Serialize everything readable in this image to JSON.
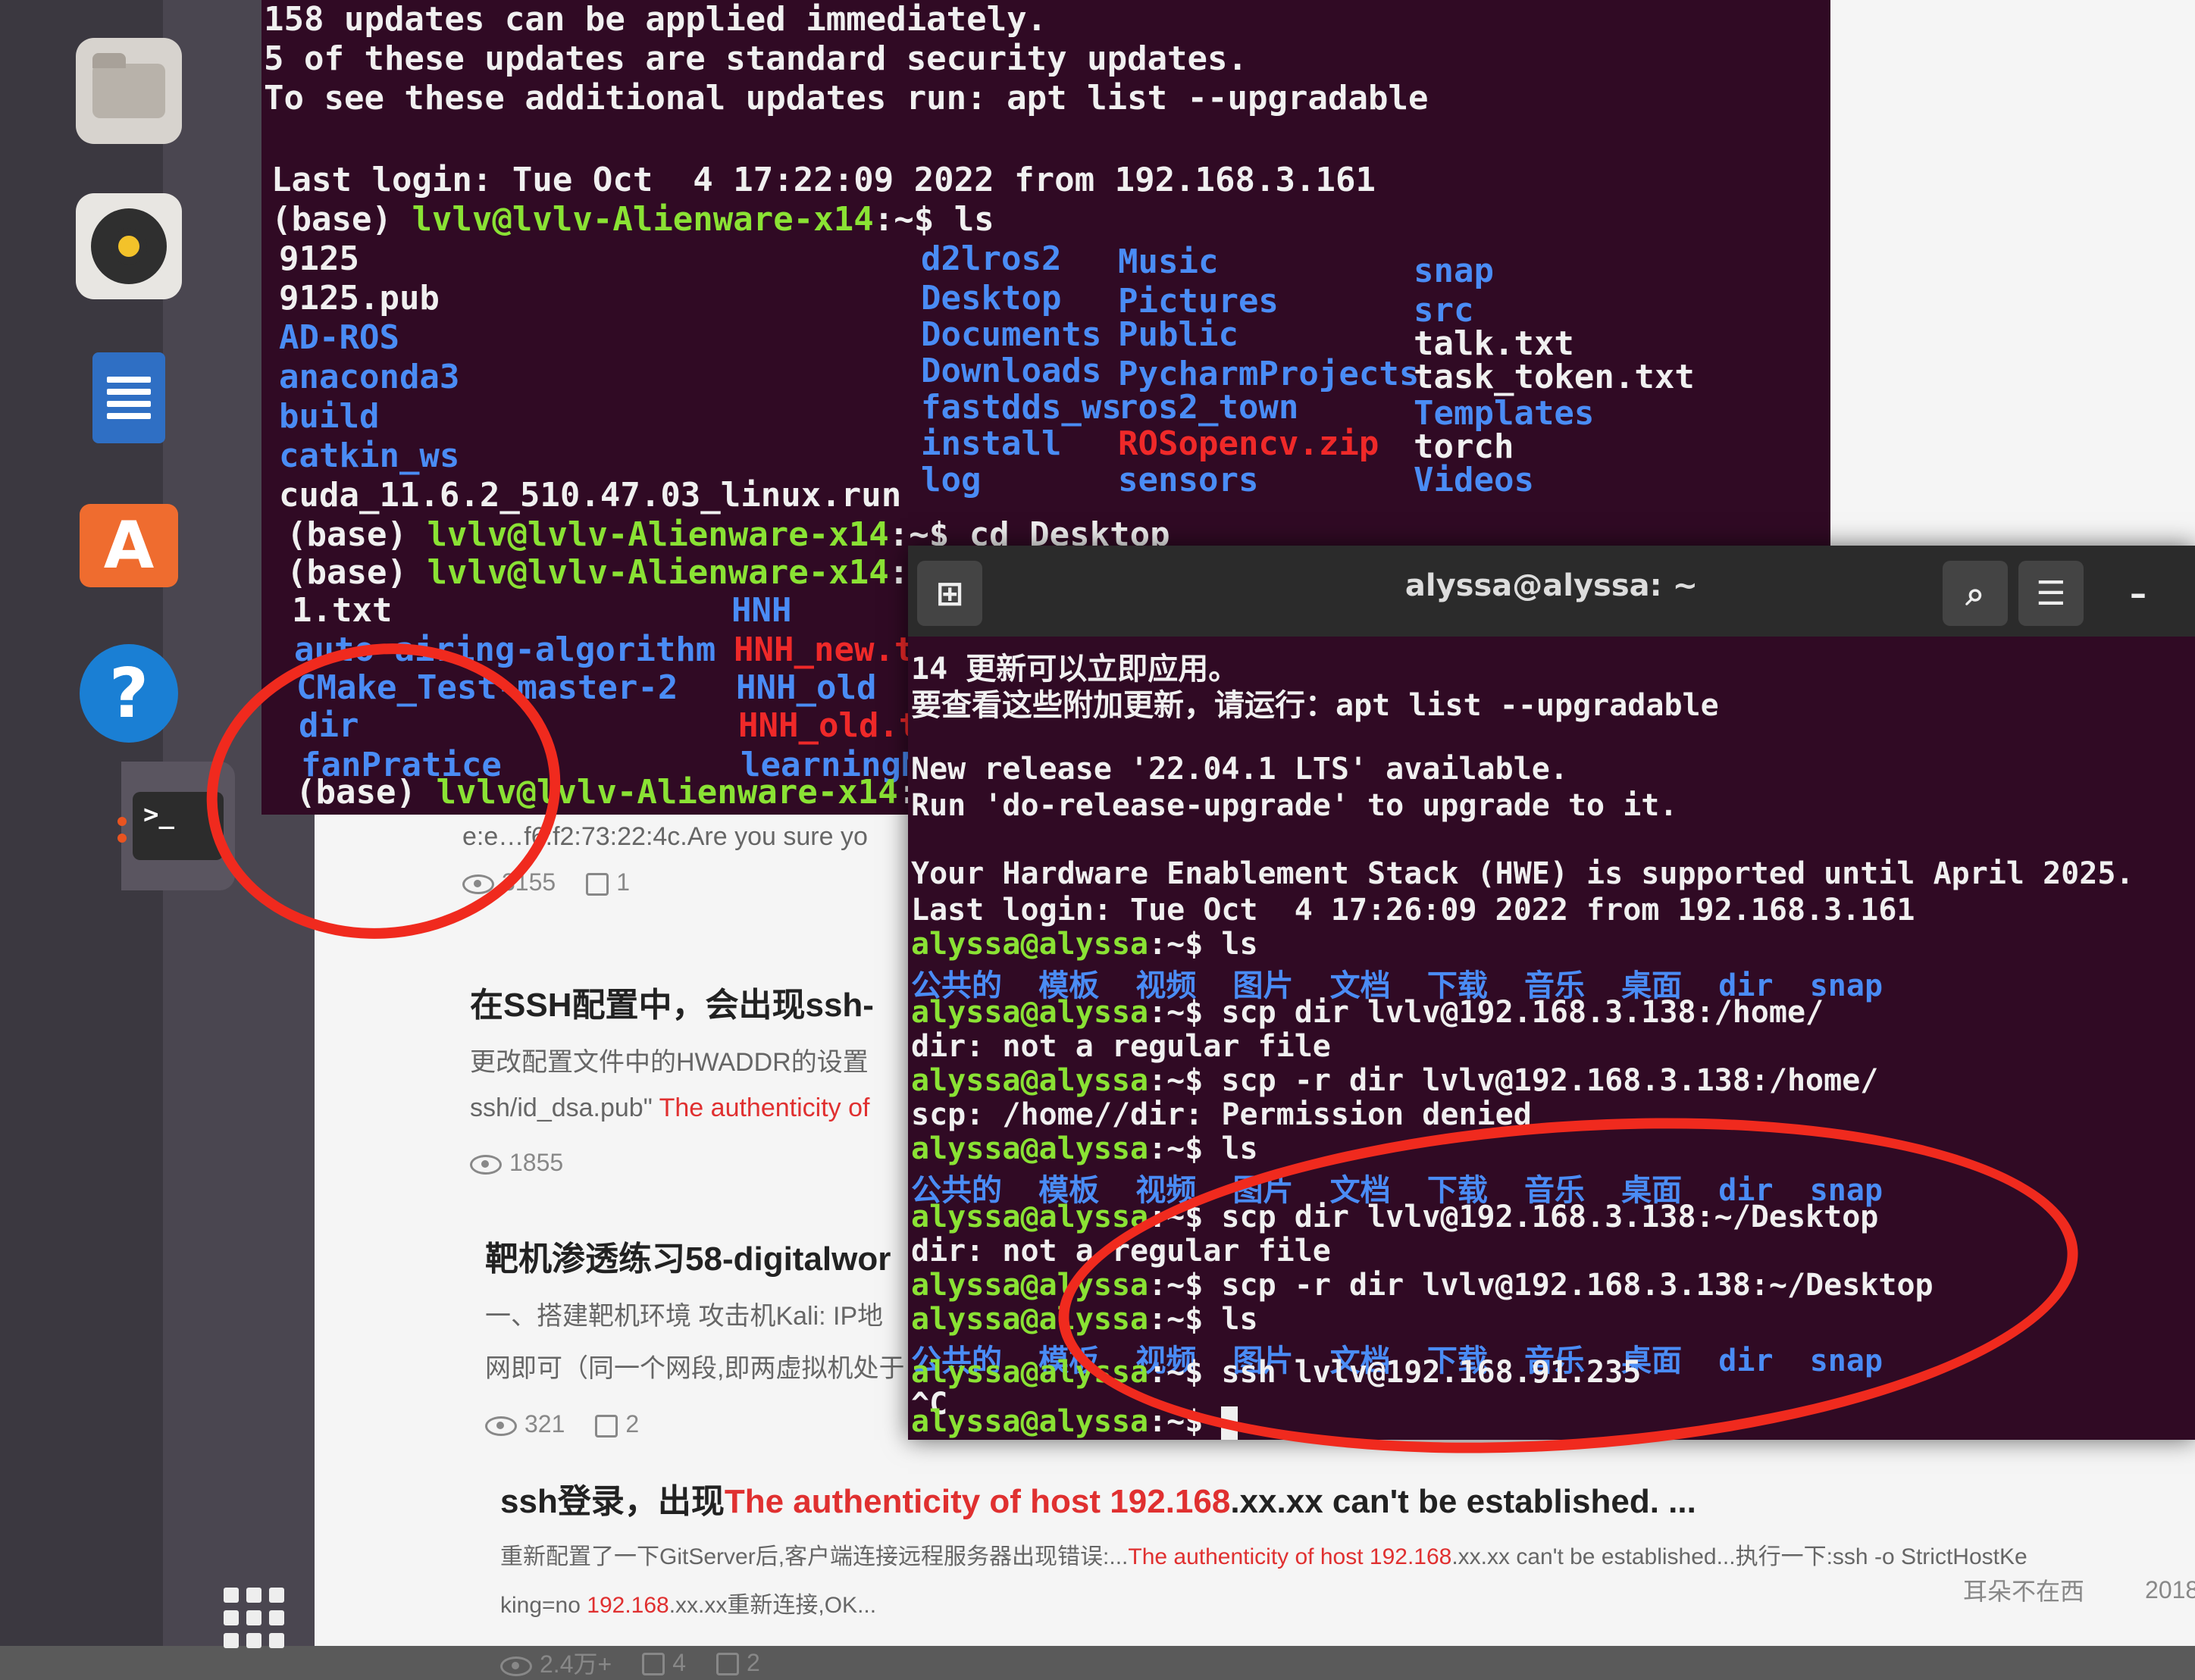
{
  "dock": {
    "items": [
      "files-icon",
      "rhythmbox-icon",
      "writer-icon",
      "software-icon",
      "help-icon",
      "terminal-icon"
    ]
  },
  "browser": {
    "articles": [
      {
        "snippet": "e:e…f6:f2:73:22:4c.Are you sure yo",
        "views": "3155",
        "likes": "1"
      },
      {
        "title": "在SSH配置中，会出现ssh-",
        "excerpt": "更改配置文件中的HWADDR的设置",
        "excerpt2_plain": "ssh/id_dsa.pub\" ",
        "excerpt2_hl": "The authenticity of",
        "views": "1855"
      },
      {
        "title": "靶机渗透练习58-digitalwor",
        "excerpt": "一、搭建靶机环境 攻击机Kali:  IP地",
        "excerpt2": "网即可（同一个网段,即两虚拟机处于",
        "views": "321",
        "likes": "2"
      },
      {
        "title_plain": "ssh登录，出现",
        "title_hl": "The authenticity of host 192.168",
        "title_tail": ".xx.xx can't be established. ...",
        "excerpt_plain": "重新配置了一下GitServer后,客户端连接远程服务器出现错误:...",
        "excerpt_hl": "The authenticity of host 192.168",
        "excerpt_tail": ".xx.xx can't be established...执行一下:ssh -o StrictHostKe",
        "excerpt2_plain": "king=no ",
        "excerpt2_hl": "192.168",
        "excerpt2_tail": ".xx.xx重新连接,OK...",
        "author": "耳朵不在西",
        "date": "2018",
        "views": "2.4万+",
        "likes": "4",
        "comments": "2"
      }
    ]
  },
  "term1": {
    "lines": [
      "158 updates can be applied immediately.",
      "5 of these updates are standard security updates.",
      "To see these additional updates run: apt list --upgradable",
      "Last login: Tue Oct  4 17:22:09 2022 from 192.168.3.161"
    ],
    "prompt_base": "(base) ",
    "prompt_user": "lvlv@lvlv-Alienware-x14",
    "prompt_suffix": ":~$ ",
    "cmd_ls": "ls",
    "cmd_cd": "cd Desktop",
    "prompt_suffix_short": ":~",
    "ls_col1": [
      {
        "t": "9125",
        "c": "w"
      },
      {
        "t": "9125.pub",
        "c": "w"
      },
      {
        "t": "AD-ROS",
        "c": "b"
      },
      {
        "t": "anaconda3",
        "c": "b"
      },
      {
        "t": "build",
        "c": "b"
      },
      {
        "t": "catkin_ws",
        "c": "b"
      },
      {
        "t": "cuda_11.6.2_510.47.03_linux.run",
        "c": "w"
      }
    ],
    "ls_col2": [
      {
        "t": "d2lros2",
        "c": "b"
      },
      {
        "t": "Desktop",
        "c": "b"
      },
      {
        "t": "Documents",
        "c": "b"
      },
      {
        "t": "Downloads",
        "c": "b"
      },
      {
        "t": "fastdds_ws",
        "c": "b"
      },
      {
        "t": "install",
        "c": "b"
      },
      {
        "t": "log",
        "c": "b"
      }
    ],
    "ls_col3": [
      {
        "t": "Music",
        "c": "b"
      },
      {
        "t": "Pictures",
        "c": "b"
      },
      {
        "t": "Public",
        "c": "b"
      },
      {
        "t": "PycharmProjects",
        "c": "b"
      },
      {
        "t": "ros2_town",
        "c": "b"
      },
      {
        "t": "ROSopencv.zip",
        "c": "r"
      },
      {
        "t": "sensors",
        "c": "b"
      }
    ],
    "ls_col4": [
      {
        "t": "snap",
        "c": "b"
      },
      {
        "t": "src",
        "c": "b"
      },
      {
        "t": "talk.txt",
        "c": "w"
      },
      {
        "t": "task_token.txt",
        "c": "w"
      },
      {
        "t": "Templates",
        "c": "b"
      },
      {
        "t": "torch",
        "c": "w"
      },
      {
        "t": "Videos",
        "c": "b"
      }
    ],
    "desk_col1": [
      {
        "t": "1.txt",
        "c": "w"
      },
      {
        "t": "auto-airing-algorithm",
        "c": "b"
      },
      {
        "t": "CMake_Test-master-2",
        "c": "b"
      },
      {
        "t": "dir",
        "c": "b"
      },
      {
        "t": "fanPratice",
        "c": "b"
      }
    ],
    "desk_col2": [
      {
        "t": "HNH",
        "c": "b"
      },
      {
        "t": "HNH_new.t",
        "c": "r"
      },
      {
        "t": "HNH_old",
        "c": "b"
      },
      {
        "t": "HNH_old.t",
        "c": "r"
      },
      {
        "t": "learningN",
        "c": "b"
      }
    ]
  },
  "term2": {
    "title": "alyssa@alyssa: ~",
    "new_tab_icon": "new-tab-icon",
    "line_update1": "14 更新可以立即应用。",
    "line_update2": "要查看这些附加更新，请运行：apt list --upgradable",
    "line_release1": "New release '22.04.1 LTS' available.",
    "line_release2": "Run 'do-release-upgrade' to upgrade to it.",
    "line_hwe": "Your Hardware Enablement Stack (HWE) is supported until April 2025.",
    "line_login": "Last login: Tue Oct  4 17:26:09 2022 from 192.168.3.161",
    "prompt": "alyssa@alyssa",
    "prompt_tail": ":~$ ",
    "cmd_ls": "ls",
    "cmd_scp1": "scp dir lvlv@192.168.3.138:/home/",
    "err_regular": "dir: not a regular file",
    "cmd_scp2": "scp -r dir lvlv@192.168.3.138:/home/",
    "err_perm": "scp: /home//dir: Permission denied",
    "cmd_scp3": "scp dir lvlv@192.168.3.138:~/Desktop",
    "cmd_scp4": "scp -r dir lvlv@192.168.3.138:~/Desktop",
    "cmd_ssh": "ssh lvlv@192.168.91.235",
    "ctrl_c": "^C",
    "ls_items": [
      "公共的",
      "模板",
      "视频",
      "图片",
      "文档",
      "下载",
      "音乐",
      "桌面",
      "dir",
      "snap"
    ]
  },
  "colors": {
    "terminal_bg": "#300a24",
    "prompt_green": "#8ae234",
    "dir_blue": "#4a8cf5",
    "archive_red": "#ef2929",
    "annotation_red": "#f02a1e"
  }
}
